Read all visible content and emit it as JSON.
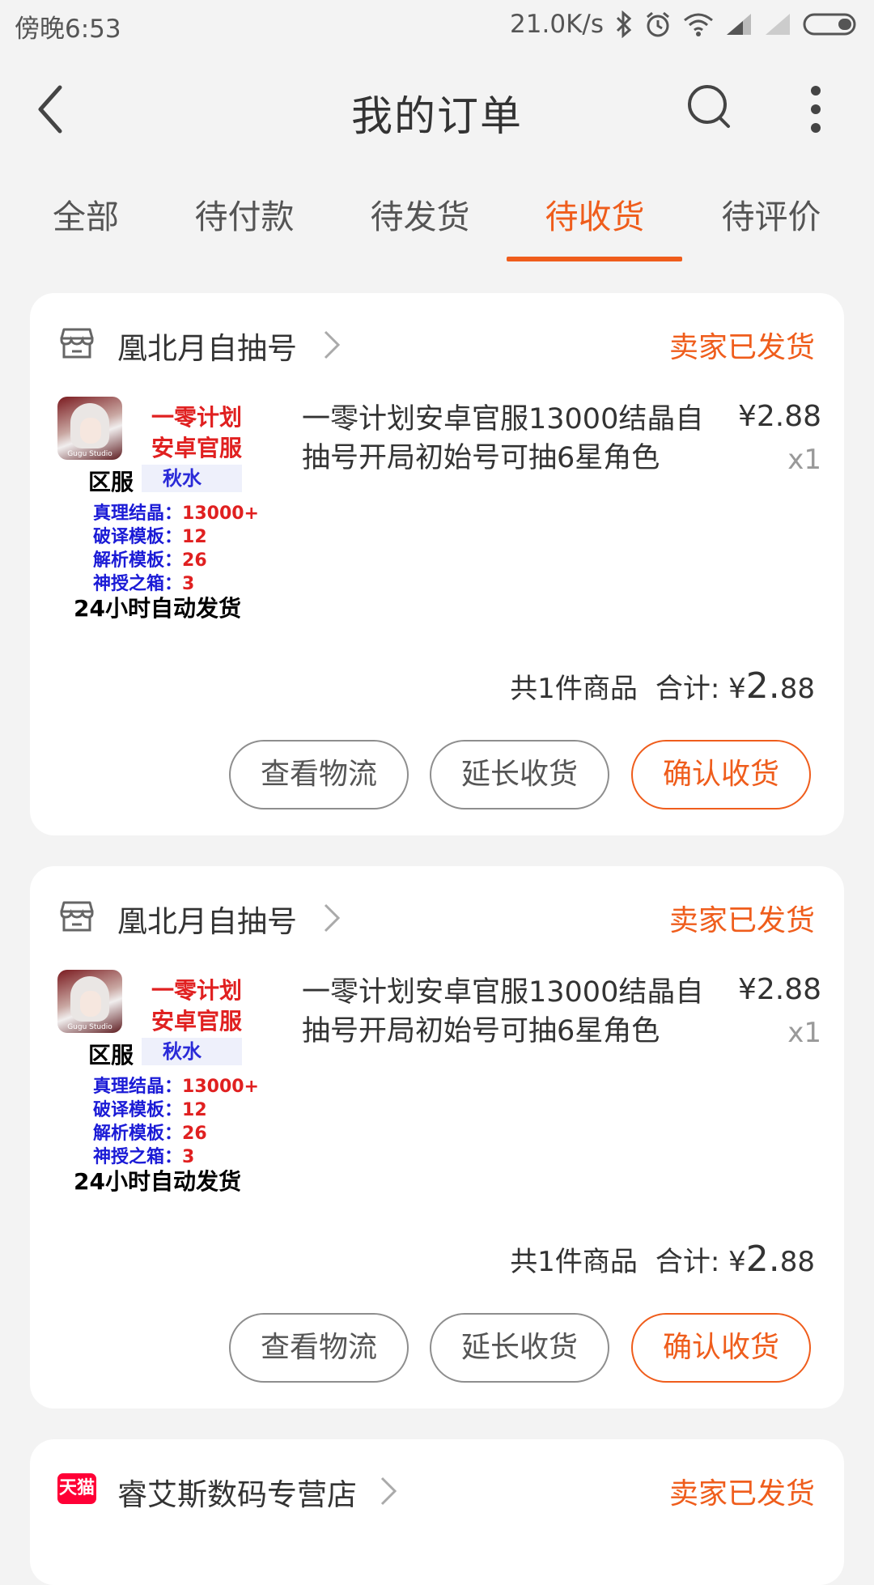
{
  "status_bar": {
    "time": "傍晚6:53",
    "network_speed": "21.0K/s",
    "icons": [
      "bluetooth-icon",
      "alarm-icon",
      "wifi-icon",
      "signal-icon",
      "signal-weak-icon",
      "battery-icon"
    ]
  },
  "header": {
    "title": "我的订单",
    "icons": [
      "back-arrow-icon",
      "search-icon",
      "more-vertical-icon"
    ]
  },
  "tabs": {
    "items": [
      {
        "label": "全部"
      },
      {
        "label": "待付款"
      },
      {
        "label": "待发货"
      },
      {
        "label": "待收货"
      },
      {
        "label": "待评价"
      }
    ],
    "active_index": 3
  },
  "colors": {
    "accent": "#ef5d1c",
    "background": "#f3f3f3",
    "card": "#ffffff",
    "tmall_red": "#ff0036"
  },
  "orders": [
    {
      "shop_name": "凰北月自抽号",
      "shop_icon": "store-icon",
      "status": "卖家已发货",
      "thumbnail": {
        "line1": "一零计划",
        "line2": "安卓官服",
        "server_label": "区服",
        "server_value": "秋水",
        "stats": [
          {
            "label": "真理结晶：",
            "value": "13000+"
          },
          {
            "label": "破译模板：",
            "value": "12"
          },
          {
            "label": "解析模板：",
            "value": "26"
          },
          {
            "label": "神授之箱：",
            "value": "3"
          }
        ],
        "footer": "24小时自动发货",
        "logo_text": "Gugu Studio"
      },
      "product_title": "一零计划安卓官服13000结晶自抽号开局初始号可抽6星角色",
      "price": "¥2.88",
      "quantity": "x1",
      "count_text": "共1件商品",
      "total_label": "合计:",
      "total_currency": "¥",
      "total_int": "2.",
      "total_dec": "88",
      "buttons": {
        "logistics": "查看物流",
        "extend": "延长收货",
        "confirm": "确认收货"
      }
    },
    {
      "shop_name": "凰北月自抽号",
      "shop_icon": "store-icon",
      "status": "卖家已发货",
      "thumbnail": {
        "line1": "一零计划",
        "line2": "安卓官服",
        "server_label": "区服",
        "server_value": "秋水",
        "stats": [
          {
            "label": "真理结晶：",
            "value": "13000+"
          },
          {
            "label": "破译模板：",
            "value": "12"
          },
          {
            "label": "解析模板：",
            "value": "26"
          },
          {
            "label": "神授之箱：",
            "value": "3"
          }
        ],
        "footer": "24小时自动发货",
        "logo_text": "Gugu Studio"
      },
      "product_title": "一零计划安卓官服13000结晶自抽号开局初始号可抽6星角色",
      "price": "¥2.88",
      "quantity": "x1",
      "count_text": "共1件商品",
      "total_label": "合计:",
      "total_currency": "¥",
      "total_int": "2.",
      "total_dec": "88",
      "buttons": {
        "logistics": "查看物流",
        "extend": "延长收货",
        "confirm": "确认收货"
      }
    },
    {
      "shop_name": "睿艾斯数码专营店",
      "shop_icon": "tmall-icon",
      "shop_badge": "天猫",
      "status": "卖家已发货"
    }
  ]
}
